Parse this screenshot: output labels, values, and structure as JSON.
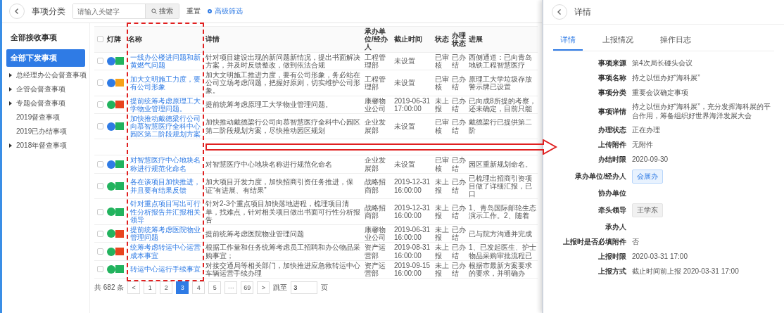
{
  "toolbar": {
    "title": "事项分类",
    "search": {
      "placeholder": "请输入关键字"
    },
    "search_button": "搜索",
    "reset": "重置",
    "advanced": "高级筛选"
  },
  "sidebar": {
    "items": [
      {
        "label": "全部接收事项",
        "selected": false
      },
      {
        "label": "全部下发事项",
        "selected": true
      }
    ],
    "tree": [
      {
        "label": "总经理办公会督查事项",
        "kind": "group"
      },
      {
        "label": "企管会督查事项",
        "kind": "group"
      },
      {
        "label": "专题会督查事项",
        "kind": "group"
      },
      {
        "label": "2019督查事项",
        "kind": "leaf"
      },
      {
        "label": "2019已办结事项",
        "kind": "leaf"
      },
      {
        "label": "2018年督查事项",
        "kind": "group"
      }
    ]
  },
  "table": {
    "all_checked": false,
    "columns": [
      "灯牌",
      "名称",
      "详情",
      "承办单位/经办人",
      "截止时间",
      "状态",
      "办理状态",
      "进展"
    ],
    "rows": [
      {
        "checked": false,
        "lights": [
          {
            "kind": "dot",
            "color": "#2f7be5"
          },
          {
            "kind": "square",
            "color": "#22b35e"
          }
        ],
        "name": "一线办公楼进问题和新黄燃气问题",
        "detail": "针对项目建设出现的新问题新情况，提出书面解决方案，并及时反馈整改，做到依法合规",
        "unit": "工程管理部",
        "deadline": "未设置",
        "status": "已审核",
        "handling": "已办结",
        "progress": "西侧通道：已向青岛地铁工程智慧医疗"
      },
      {
        "checked": false,
        "lights": [
          {
            "kind": "dot",
            "color": "#2f7be5"
          },
          {
            "kind": "square",
            "color": "#f7a11a"
          }
        ],
        "name": "加大文明施工力度，要有公司形象",
        "detail": "加大文明施工推进力度，要有公司形象，务必站在公司立场考虑问题，把握好原则，切实维护公司形象。",
        "unit": "工程管理部",
        "deadline": "未设置",
        "status": "已审核",
        "handling": "已办结",
        "progress": "原理工大学垃圾存放警示牌已设置"
      },
      {
        "checked": false,
        "lights": [
          {
            "kind": "dot",
            "color": "#22b35e"
          },
          {
            "kind": "square",
            "color": "#e8441f"
          }
        ],
        "name": "提前统筹考虑原理工大学物业管理问题。",
        "detail": "提前统筹考虑原理工大学物业管理问题。",
        "unit": "康馨物业公司",
        "deadline": "2019-06-31 17:00:00",
        "status": "未上报",
        "handling": "已办结",
        "progress": "已向成8所提的考察，还未确定，目前只能"
      },
      {
        "checked": false,
        "lights": [
          {
            "kind": "dot",
            "color": "#2f7be5"
          },
          {
            "kind": "square",
            "color": "#22b35e"
          }
        ],
        "name": "加快推动戴德梁行公司向慕智慧医疗全科中心园区第二阶段规划方案",
        "detail": "加快推动戴德梁行公司向慕智慧医疗全科中心园区第二阶段规划方案，尽快推动园区规划",
        "unit": "企业发展部",
        "deadline": "未设置",
        "status": "已审核",
        "handling": "已办结",
        "progress": "戴德梁行已提供第二阶"
      },
      {
        "checked": false,
        "lights": [
          {
            "kind": "dot",
            "color": "#2f7be5"
          },
          {
            "kind": "square",
            "color": "#22b35e"
          }
        ],
        "name": "对智慧医疗中心地块名称进行规范化命名",
        "detail": "对智慧医疗中心地块名称进行规范化命名",
        "unit": "企业发展部",
        "deadline": "未设置",
        "status": "已审核",
        "handling": "已办结",
        "progress": "园区重新规划命名。"
      },
      {
        "checked": false,
        "lights": [
          {
            "kind": "dot",
            "color": "#22b35e"
          },
          {
            "kind": "square",
            "color": "#22b35e"
          }
        ],
        "name": "各在谈项目加快推进，并且要有结果反馈",
        "detail": "加大项目开发力度，加快招商引资任务推进，保证“有进展、有结果”",
        "unit": "战略招商部",
        "deadline": "2019-12-31 16:00:00",
        "status": "未上报",
        "handling": "已办结",
        "progress": "已梳理出招商引资项目做了详细汇报，已口"
      },
      {
        "checked": false,
        "lights": [
          {
            "kind": "dot",
            "color": "#22b35e"
          },
          {
            "kind": "square",
            "color": "#22b35e"
          }
        ],
        "name": "针对重点项目写出可行性分析报告并汇报相关领导",
        "detail": "针对2-3个重点项目加快落地进程，梳理项目清单，找难点，针对相关项目做出书面可行性分析报告",
        "unit": "战略招商部",
        "deadline": "2019-12-31 16:00:00",
        "status": "未上报",
        "handling": "已办结",
        "progress": "1、青岛国际邮轮生态演示工作。2、随着"
      },
      {
        "checked": false,
        "lights": [
          {
            "kind": "dot",
            "color": "#22b35e"
          },
          {
            "kind": "square",
            "color": "#e8441f"
          }
        ],
        "name": "提前统筹考虑医院物业管理问题",
        "detail": "提前统筹考虑医院物业管理问题",
        "unit": "康馨物业公司",
        "deadline": "2019-06-31 16:00:00",
        "status": "未上报",
        "handling": "已办结",
        "progress": "已与院方沟通并完成"
      },
      {
        "checked": false,
        "lights": [
          {
            "kind": "dot",
            "color": "#22b35e"
          },
          {
            "kind": "square",
            "color": "#e8441f"
          }
        ],
        "name": "统筹考虑转运中心运营成本事宜",
        "detail": "根据工作量和任务统筹考虑员工招聘和办公物品采购事宜；",
        "unit": "资产运营部",
        "deadline": "2019-08-31 16:00:00",
        "status": "未上报",
        "handling": "已办结",
        "progress": "1、已发起医生、护士物品采购审批流程已"
      },
      {
        "checked": false,
        "lights": [
          {
            "kind": "dot",
            "color": "#22b35e"
          },
          {
            "kind": "square",
            "color": "#22b35e"
          }
        ],
        "name": "转运中心运行手续事宜",
        "detail": "对接交通局等相关部门，加快推进应急救转运中心车辆运营手续办理",
        "unit": "资产运营部",
        "deadline": "2019-09-15 16:00:00",
        "status": "未上报",
        "handling": "已办结",
        "progress": "根据市最新方案要求的要求，并明确办"
      }
    ]
  },
  "pagination": {
    "total": "共 682 条",
    "prev": "<",
    "next": ">",
    "pages": [
      {
        "label": "1",
        "selected": false
      },
      {
        "label": "2",
        "selected": false
      },
      {
        "label": "3",
        "selected": true
      },
      {
        "label": "4",
        "selected": false
      },
      {
        "label": "5",
        "selected": false
      },
      {
        "label": "···",
        "selected": false
      },
      {
        "label": "69",
        "selected": false
      }
    ],
    "jump_label": "跳至",
    "jump_value": "3",
    "page_unit": "页"
  },
  "detail_panel": {
    "title": "详情",
    "tabs": [
      {
        "label": "详情",
        "selected": true
      },
      {
        "label": "上报情况",
        "selected": false
      },
      {
        "label": "操作日志",
        "selected": false
      }
    ],
    "fields": [
      {
        "label": "事项来源",
        "value": "第4次局长碰头会议",
        "kind": "text"
      },
      {
        "label": "事项名称",
        "value": "持之以恒办好“海科展”",
        "kind": "text"
      },
      {
        "label": "事项分类",
        "value": "重要会议确定事项",
        "kind": "text"
      },
      {
        "label": "事项详情",
        "value": "持之以恒办好“海科展”，充分发挥海科展的平台作用，筹备组织好世界海洋发展大会",
        "kind": "text"
      },
      {
        "label": "办理状态",
        "value": "正在办理",
        "kind": "text"
      },
      {
        "label": "上传附件",
        "value": "无附件",
        "kind": "text"
      },
      {
        "label": "办结时限",
        "value": "2020-09-30",
        "kind": "text"
      },
      {
        "label": "承办单位/经办人",
        "value": "会展办",
        "kind": "tag"
      },
      {
        "label": "协办单位",
        "kind": "text"
      },
      {
        "label": "牵头领导",
        "value": "王学东",
        "kind": "chip"
      },
      {
        "label": "承办人",
        "kind": "text"
      },
      {
        "label": "上报时是否必填附件",
        "value": "否",
        "kind": "text"
      },
      {
        "label": "上报时限",
        "value": "2020-03-31 17:00",
        "kind": "text"
      },
      {
        "label": "上报方式",
        "value": "截止时间前上报 2020-03-31 17:00",
        "kind": "text"
      }
    ]
  }
}
